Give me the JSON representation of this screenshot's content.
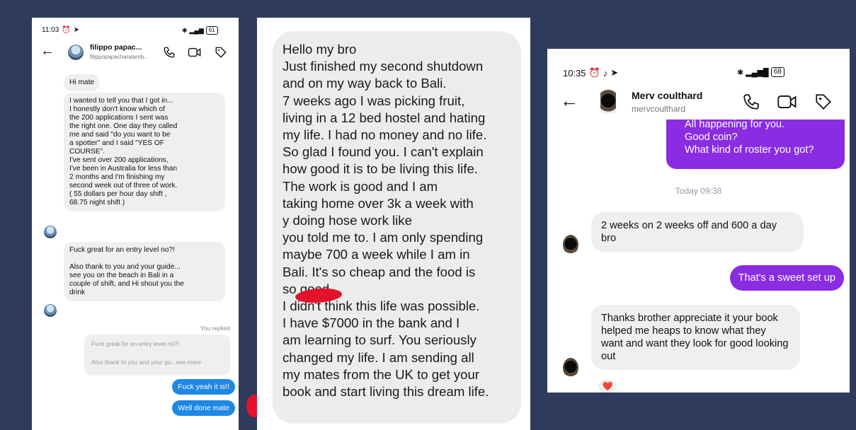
{
  "left_screenshot": {
    "status": {
      "time": "11:03",
      "battery": "61"
    },
    "header": {
      "name": "filippo papac...",
      "handle": "filippopapacharalamb..."
    },
    "messages": [
      {
        "text": "Hi mate"
      },
      {
        "text": "I wanted to tell you that I got in...\nI honestly don't know which of\nthe 200 applications I sent was\nthe right one. One day they called\nme and said \"do you want to be\na spotter\" and I said \"YES OF\nCOURSE\".\nI've sent over 200 applications,\nI've been in Australia for less than\n2 months and I'm finishing my\nsecond week out of three of work.\n( 55 dollars per hour day shift ,\n68.75 night shift )"
      },
      {
        "text": "Fuck great for an entry level no?!\n\nAlso thank to you and your guide...\nsee you on the beach in Bali in a\ncouple of shift, and Hi shout you the\ndrink"
      }
    ],
    "you_replied": "You replied",
    "reply_preview": {
      "line1": "Fuck great for an entry level no?!",
      "line2": "Also thank to you and your gu...see more"
    },
    "outgoing": [
      {
        "text": "Fuck yeah it is!!"
      },
      {
        "text": "Well done mate"
      }
    ]
  },
  "middle_screenshot": {
    "message": "Hello my bro\nJust finished my second shutdown\nand on my way back to Bali.\n7 weeks ago I was picking fruit,\nliving in a 12 bed hostel and hating\nmy life. I had no money and no life.\nSo glad I found you. I can't explain\nhow good it is to be living this life.\nThe work is good and I am\ntaking home over 3k a week with\n         y doing hose work like\nyou told me to. I am only spending\nmaybe 700 a week while I am in\nBali. It's so cheap and the food is\nso good.\nI didn't think this life was possible.\nI have $7000 in the bank and I\nam learning to surf. You seriously\nchanged my life. I am sending all\nmy mates from the UK to get your\nbook and start living this dream life."
  },
  "right_screenshot": {
    "status": {
      "time": "10:35",
      "battery": "68"
    },
    "header": {
      "name": "Merv coulthard",
      "handle": "mervcoulthard"
    },
    "top_outgoing": {
      "line1": "All happening for you.",
      "line2": "Good coin?",
      "line3": "What kind of roster you got?"
    },
    "timestamp": "Today 09:38",
    "incoming1": "2 weeks on 2 weeks off and 600 a day bro",
    "outgoing1": "That's a sweet set up",
    "incoming2": "Thanks brother appreciate it your book helped me heaps to know what they want and want they look for good looking out",
    "reaction": "❤️",
    "colors": {
      "outgoing_bubble": "#8a2ce2",
      "incoming_bubble": "#efefef"
    }
  }
}
